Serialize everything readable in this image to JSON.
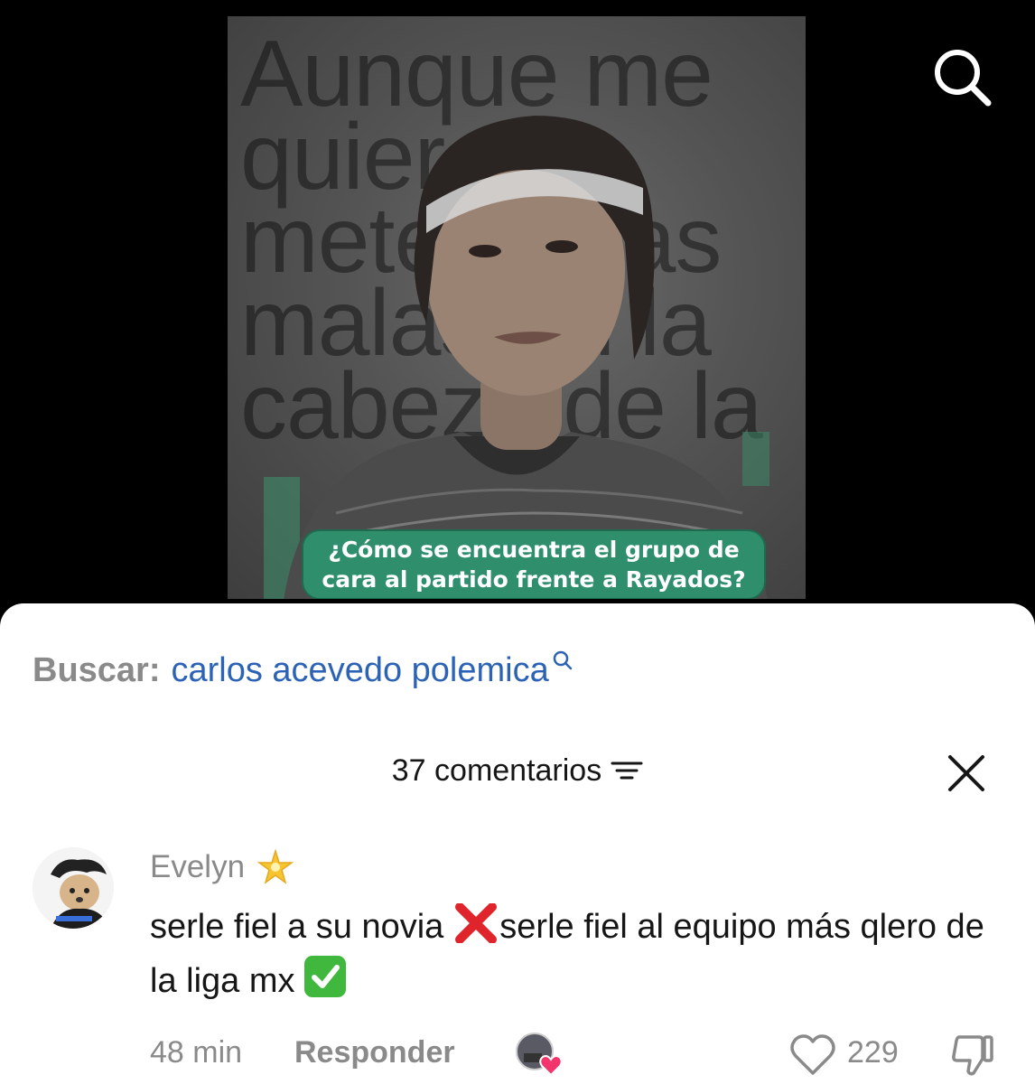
{
  "video": {
    "overlay_text": "Aunque    me\nquiero\nmeter   ideas\nmalas  en la\ncabeza  de la",
    "caption_line1": "¿Cómo se encuentra el grupo de",
    "caption_line2": "cara al partido frente a Rayados?",
    "search_icon": "search-icon"
  },
  "search_suggestion": {
    "label": "Buscar:",
    "query": "carlos acevedo polemica"
  },
  "comments_header": {
    "title": "37 comentarios",
    "filter_icon": "filter-icon",
    "close_icon": "close-icon"
  },
  "comment": {
    "username": "Evelyn",
    "badge_icon": "star-icon",
    "text_part1": "serle fiel a su novia",
    "text_part2": "serle fiel al equipo más qlero de la liga mx",
    "time": "48 min",
    "reply_label": "Responder",
    "like_count": "229",
    "colors": {
      "link": "#2c63b6",
      "muted": "#8a8a8a",
      "x_red": "#e0242b",
      "check_green": "#3fb83d"
    }
  }
}
